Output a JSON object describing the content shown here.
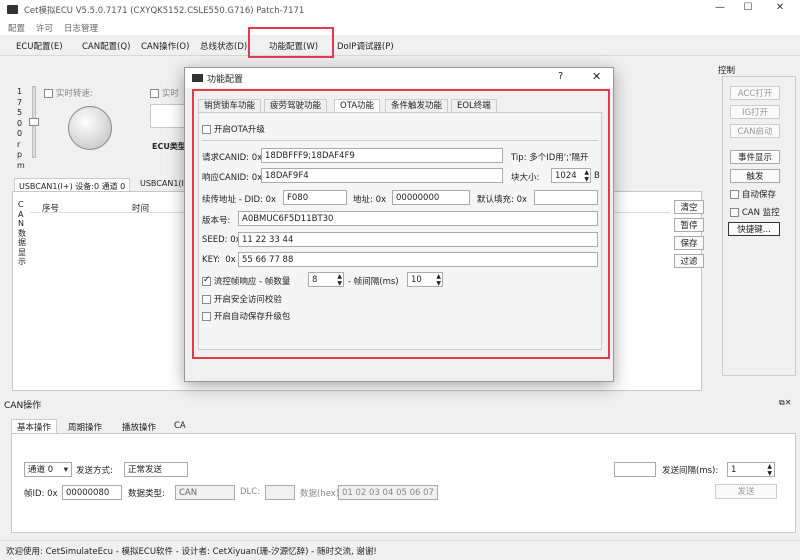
{
  "window": {
    "title": "Cet模拟ECU V5.5.0.7171 (CXYQK5152.CSLE550.G716) Patch-7171"
  },
  "menu": [
    "配置",
    "许可",
    "日志管理"
  ],
  "main_tabs": [
    "ECU配置(E)",
    "CAN配置(Q)",
    "CAN操作(O)",
    "总线状态(D)",
    "功能配置(W)",
    "DoIP调试器(P)"
  ],
  "left": {
    "rpm_vertical": "17500rpm",
    "realtime_speed": "实时转速:",
    "realtime_2": "实时",
    "ecu_type": "ECU类型"
  },
  "log": {
    "tabs": [
      "USBCAN1(I+) 设备:0 通道 0",
      "USBCAN1(I"
    ],
    "side_label": "CAN数据显示",
    "columns": [
      "序号",
      "时间"
    ],
    "buttons": [
      "清空",
      "暂停",
      "保存",
      "过滤"
    ]
  },
  "control": {
    "title": "控制",
    "buttons": [
      "ACC打开",
      "IG打开",
      "CAN启动",
      "事件显示",
      "触发"
    ],
    "auto_save": "自动保存",
    "can_monitor": "CAN 监控",
    "shortcut": "快捷键..."
  },
  "can_ops": {
    "title": "CAN操作",
    "tabs": [
      "基本操作",
      "周期操作",
      "播放操作",
      "CA"
    ],
    "channel": "通道 0",
    "send_mode_label": "发送方式:",
    "send_mode": "正常发送",
    "frame_id_label": "帧ID: 0x",
    "frame_id": "00000080",
    "data_type_label": "数据类型:",
    "data_type": "CAN",
    "dlc_label": "DLC:",
    "data_label": "数据(hex):",
    "data": "01 02 03 04 05 06 07 08",
    "interval_label": "发送间隔(ms):",
    "interval": "1",
    "send_button": "发送"
  },
  "dialog": {
    "title": "功能配置",
    "help": "?",
    "close": "✕",
    "tabs": [
      "销货锁车功能",
      "疲劳驾驶功能",
      "OTA功能",
      "条件触发功能",
      "EOL终端"
    ],
    "active_tab": 2,
    "enable_ota": "开启OTA升级",
    "req_canid_label": "请求CANID: 0x",
    "req_canid": "18DBFFF9;18DAF4F9",
    "tip": "Tip: 多个ID用';'隔开",
    "resp_canid_label": "响应CANID: 0x",
    "resp_canid": "18DAF9F4",
    "block_size_label": "块大小:",
    "block_size": "1024",
    "block_unit": "B",
    "cont_addr_label": "续传地址 - DID: 0x",
    "cont_did": "F080",
    "addr_label": "地址: 0x",
    "addr": "00000000",
    "default_fill_label": "默认填充: 0x",
    "default_fill": "",
    "version_label": "版本号:",
    "version": "A0BMUC6F5D11BT30",
    "seed_label": "SEED: 0x",
    "seed": "11 22 33 44",
    "key_label": "KEY:  0x",
    "key": "55 66 77 88",
    "flow_control": "流控帧响应 - 帧数量",
    "frame_count": "8",
    "frame_interval_label": "- 帧间隔(ms)",
    "frame_interval": "10",
    "secure_access": "开启安全访问校验",
    "auto_save_pkg": "开启自动保存升级包"
  },
  "status": "欢迎使用: CetSimulateEcu - 模拟ECU软件 - 设计者: CetXiyuan(珊-汐源忆辞) - 随时交流, 谢谢!"
}
